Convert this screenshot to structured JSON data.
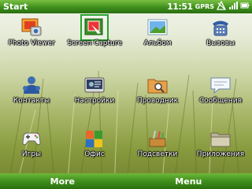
{
  "titlebar": {
    "title": "Start",
    "time": "11:51",
    "network": "GPRS"
  },
  "apps": [
    {
      "label": "Photo Viewer",
      "icon": "photo-viewer-icon"
    },
    {
      "label": "Screen Capture",
      "icon": "screen-capture-icon"
    },
    {
      "label": "Альбом",
      "icon": "album-icon"
    },
    {
      "label": "Вызовы",
      "icon": "phone-icon"
    },
    {
      "label": "Контакты",
      "icon": "contacts-icon"
    },
    {
      "label": "Настройки",
      "icon": "settings-icon"
    },
    {
      "label": "Проводник",
      "icon": "folder-search-icon"
    },
    {
      "label": "Сообщения",
      "icon": "messages-icon"
    },
    {
      "label": "Игры",
      "icon": "gamepad-icon"
    },
    {
      "label": "Офис",
      "icon": "office-icon"
    },
    {
      "label": "Подсветки",
      "icon": "tools-icon"
    },
    {
      "label": "Приложения",
      "icon": "applications-folder-icon"
    }
  ],
  "softkeys": {
    "left": "More",
    "right": "Menu"
  },
  "colors": {
    "bar_green": "#3f8f1d",
    "highlight": "#29a32e"
  }
}
